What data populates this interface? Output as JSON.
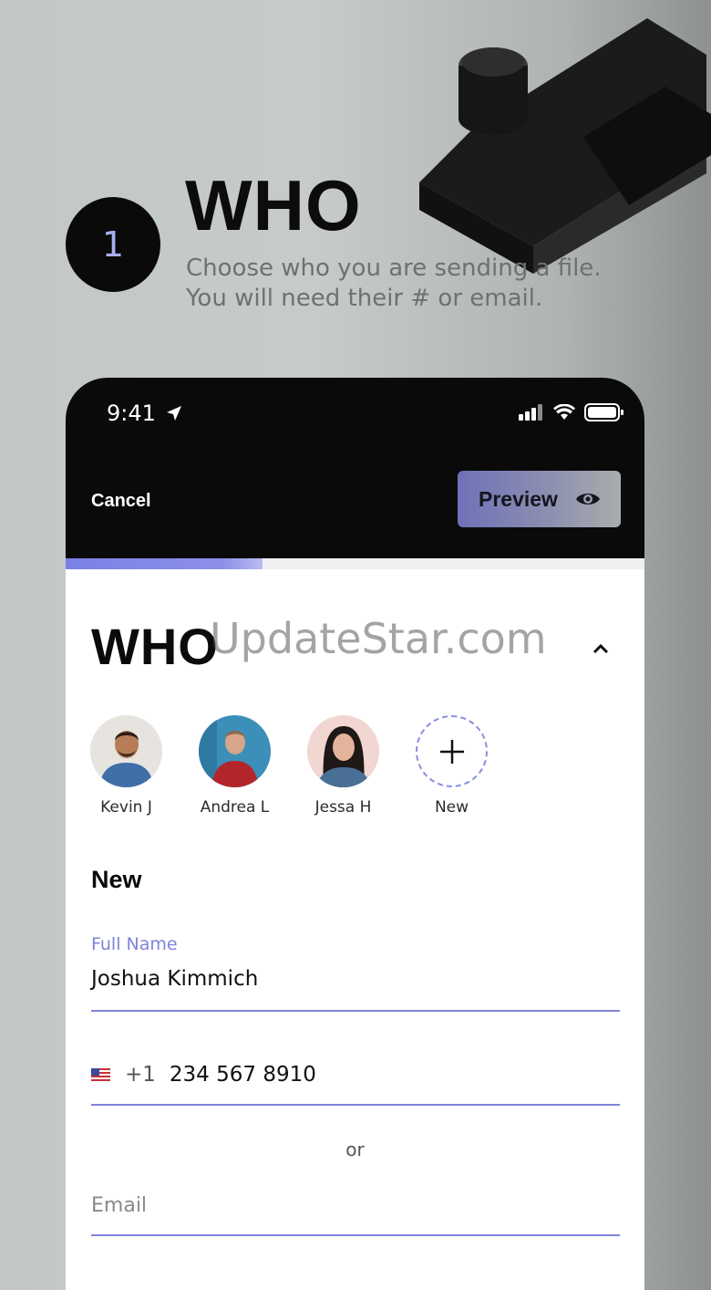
{
  "hero": {
    "step_number": "1",
    "title": "WHO",
    "subtitle_line1": "Choose who you are sending a file.",
    "subtitle_line2": "You will need their # or email."
  },
  "status_bar": {
    "time": "9:41"
  },
  "nav": {
    "cancel_label": "Cancel",
    "preview_label": "Preview"
  },
  "progress": {
    "fraction": 0.34
  },
  "section": {
    "title": "WHO",
    "watermark": "UpdateStar.com"
  },
  "contacts": [
    {
      "name": "Kevin J"
    },
    {
      "name": "Andrea L"
    },
    {
      "name": "Jessa H"
    },
    {
      "name": "New"
    }
  ],
  "form": {
    "heading": "New",
    "full_name_label": "Full Name",
    "full_name_value": "Joshua Kimmich",
    "country_code": "+1",
    "phone_value": "234 567 8910",
    "or_label": "or",
    "email_placeholder": "Email"
  },
  "colors": {
    "accent": "#7e83d8",
    "dark": "#0a0a0b"
  }
}
